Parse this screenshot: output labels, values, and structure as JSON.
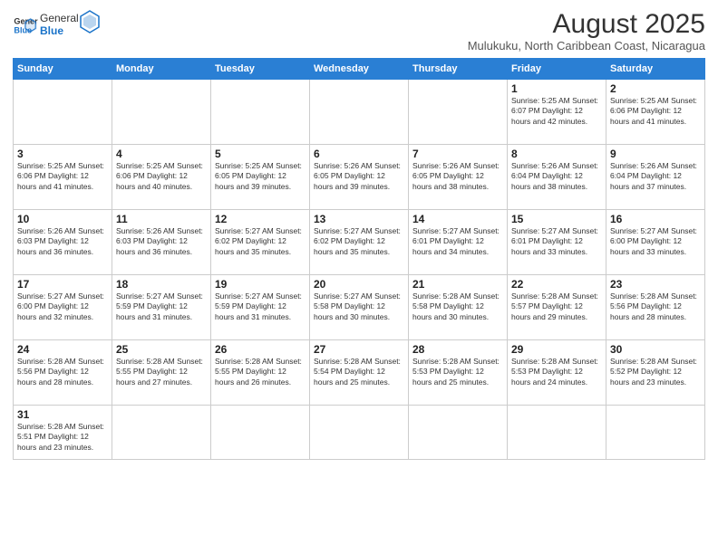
{
  "logo": {
    "line1": "General",
    "line2": "Blue"
  },
  "title": "August 2025",
  "subtitle": "Mulukuku, North Caribbean Coast, Nicaragua",
  "days_of_week": [
    "Sunday",
    "Monday",
    "Tuesday",
    "Wednesday",
    "Thursday",
    "Friday",
    "Saturday"
  ],
  "weeks": [
    [
      {
        "day": "",
        "info": ""
      },
      {
        "day": "",
        "info": ""
      },
      {
        "day": "",
        "info": ""
      },
      {
        "day": "",
        "info": ""
      },
      {
        "day": "",
        "info": ""
      },
      {
        "day": "1",
        "info": "Sunrise: 5:25 AM\nSunset: 6:07 PM\nDaylight: 12 hours and 42 minutes."
      },
      {
        "day": "2",
        "info": "Sunrise: 5:25 AM\nSunset: 6:06 PM\nDaylight: 12 hours and 41 minutes."
      }
    ],
    [
      {
        "day": "3",
        "info": "Sunrise: 5:25 AM\nSunset: 6:06 PM\nDaylight: 12 hours and 41 minutes."
      },
      {
        "day": "4",
        "info": "Sunrise: 5:25 AM\nSunset: 6:06 PM\nDaylight: 12 hours and 40 minutes."
      },
      {
        "day": "5",
        "info": "Sunrise: 5:25 AM\nSunset: 6:05 PM\nDaylight: 12 hours and 39 minutes."
      },
      {
        "day": "6",
        "info": "Sunrise: 5:26 AM\nSunset: 6:05 PM\nDaylight: 12 hours and 39 minutes."
      },
      {
        "day": "7",
        "info": "Sunrise: 5:26 AM\nSunset: 6:05 PM\nDaylight: 12 hours and 38 minutes."
      },
      {
        "day": "8",
        "info": "Sunrise: 5:26 AM\nSunset: 6:04 PM\nDaylight: 12 hours and 38 minutes."
      },
      {
        "day": "9",
        "info": "Sunrise: 5:26 AM\nSunset: 6:04 PM\nDaylight: 12 hours and 37 minutes."
      }
    ],
    [
      {
        "day": "10",
        "info": "Sunrise: 5:26 AM\nSunset: 6:03 PM\nDaylight: 12 hours and 36 minutes."
      },
      {
        "day": "11",
        "info": "Sunrise: 5:26 AM\nSunset: 6:03 PM\nDaylight: 12 hours and 36 minutes."
      },
      {
        "day": "12",
        "info": "Sunrise: 5:27 AM\nSunset: 6:02 PM\nDaylight: 12 hours and 35 minutes."
      },
      {
        "day": "13",
        "info": "Sunrise: 5:27 AM\nSunset: 6:02 PM\nDaylight: 12 hours and 35 minutes."
      },
      {
        "day": "14",
        "info": "Sunrise: 5:27 AM\nSunset: 6:01 PM\nDaylight: 12 hours and 34 minutes."
      },
      {
        "day": "15",
        "info": "Sunrise: 5:27 AM\nSunset: 6:01 PM\nDaylight: 12 hours and 33 minutes."
      },
      {
        "day": "16",
        "info": "Sunrise: 5:27 AM\nSunset: 6:00 PM\nDaylight: 12 hours and 33 minutes."
      }
    ],
    [
      {
        "day": "17",
        "info": "Sunrise: 5:27 AM\nSunset: 6:00 PM\nDaylight: 12 hours and 32 minutes."
      },
      {
        "day": "18",
        "info": "Sunrise: 5:27 AM\nSunset: 5:59 PM\nDaylight: 12 hours and 31 minutes."
      },
      {
        "day": "19",
        "info": "Sunrise: 5:27 AM\nSunset: 5:59 PM\nDaylight: 12 hours and 31 minutes."
      },
      {
        "day": "20",
        "info": "Sunrise: 5:27 AM\nSunset: 5:58 PM\nDaylight: 12 hours and 30 minutes."
      },
      {
        "day": "21",
        "info": "Sunrise: 5:28 AM\nSunset: 5:58 PM\nDaylight: 12 hours and 30 minutes."
      },
      {
        "day": "22",
        "info": "Sunrise: 5:28 AM\nSunset: 5:57 PM\nDaylight: 12 hours and 29 minutes."
      },
      {
        "day": "23",
        "info": "Sunrise: 5:28 AM\nSunset: 5:56 PM\nDaylight: 12 hours and 28 minutes."
      }
    ],
    [
      {
        "day": "24",
        "info": "Sunrise: 5:28 AM\nSunset: 5:56 PM\nDaylight: 12 hours and 28 minutes."
      },
      {
        "day": "25",
        "info": "Sunrise: 5:28 AM\nSunset: 5:55 PM\nDaylight: 12 hours and 27 minutes."
      },
      {
        "day": "26",
        "info": "Sunrise: 5:28 AM\nSunset: 5:55 PM\nDaylight: 12 hours and 26 minutes."
      },
      {
        "day": "27",
        "info": "Sunrise: 5:28 AM\nSunset: 5:54 PM\nDaylight: 12 hours and 25 minutes."
      },
      {
        "day": "28",
        "info": "Sunrise: 5:28 AM\nSunset: 5:53 PM\nDaylight: 12 hours and 25 minutes."
      },
      {
        "day": "29",
        "info": "Sunrise: 5:28 AM\nSunset: 5:53 PM\nDaylight: 12 hours and 24 minutes."
      },
      {
        "day": "30",
        "info": "Sunrise: 5:28 AM\nSunset: 5:52 PM\nDaylight: 12 hours and 23 minutes."
      }
    ],
    [
      {
        "day": "31",
        "info": "Sunrise: 5:28 AM\nSunset: 5:51 PM\nDaylight: 12 hours and 23 minutes."
      },
      {
        "day": "",
        "info": ""
      },
      {
        "day": "",
        "info": ""
      },
      {
        "day": "",
        "info": ""
      },
      {
        "day": "",
        "info": ""
      },
      {
        "day": "",
        "info": ""
      },
      {
        "day": "",
        "info": ""
      }
    ]
  ]
}
